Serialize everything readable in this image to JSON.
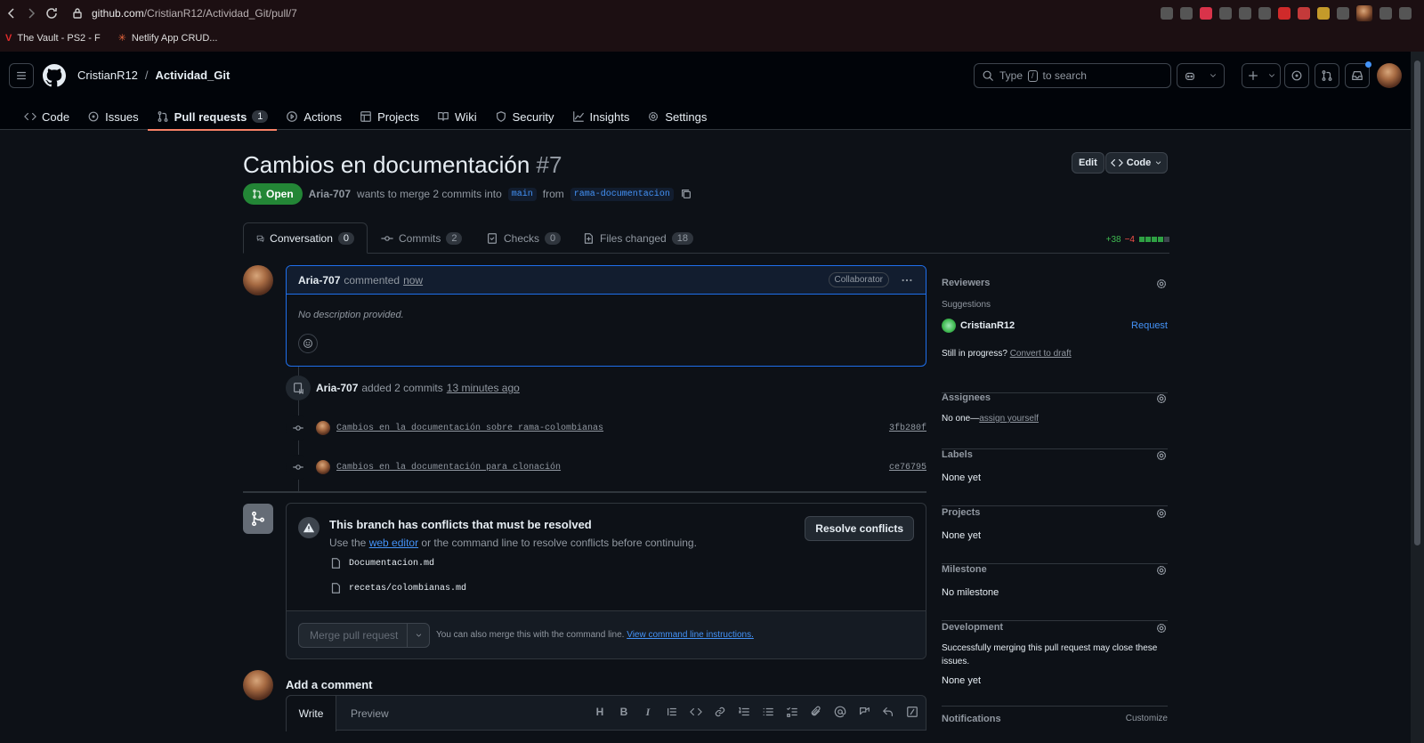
{
  "browser": {
    "url_host": "github.com",
    "url_path": "/CristianR12/Actividad_Git/pull/7",
    "bookmarks": [
      "The Vault - PS2 - F",
      "Netlify App CRUD..."
    ]
  },
  "header": {
    "owner": "CristianR12",
    "separator": "/",
    "repo": "Actividad_Git",
    "search_prefix": "Type",
    "search_key": "/",
    "search_suffix": "to search"
  },
  "repo_tabs": [
    {
      "label": "Code",
      "icon": "code-icon"
    },
    {
      "label": "Issues",
      "icon": "issue-icon"
    },
    {
      "label": "Pull requests",
      "icon": "pull-request-icon",
      "count": "1",
      "active": true
    },
    {
      "label": "Actions",
      "icon": "play-icon"
    },
    {
      "label": "Projects",
      "icon": "table-icon"
    },
    {
      "label": "Wiki",
      "icon": "book-icon"
    },
    {
      "label": "Security",
      "icon": "shield-icon"
    },
    {
      "label": "Insights",
      "icon": "graph-icon"
    },
    {
      "label": "Settings",
      "icon": "gear-icon"
    }
  ],
  "pr": {
    "title": "Cambios en documentación",
    "number": "#7",
    "edit_label": "Edit",
    "code_label": "Code",
    "state": "Open",
    "author": "Aria-707",
    "merge_text": "wants to merge 2 commits into",
    "base_branch": "main",
    "from_text": "from",
    "head_branch": "rama-documentacion"
  },
  "pr_tabs": [
    {
      "label": "Conversation",
      "count": "0"
    },
    {
      "label": "Commits",
      "count": "2"
    },
    {
      "label": "Files changed",
      "count": "18"
    },
    {
      "label": "Checks",
      "count": "0"
    }
  ],
  "diffstat": {
    "additions": "+38",
    "deletions": "−4",
    "blocks_green": 0.8
  },
  "comment": {
    "author": "Aria-707",
    "action": "commented",
    "time": "now",
    "role": "Collaborator",
    "body": "No description provided."
  },
  "timeline": {
    "author": "Aria-707",
    "action": "added 2 commits",
    "time": "13 minutes ago",
    "commits": [
      {
        "message": "Cambios en la documentación sobre rama-colombianas",
        "sha": "3fb280f"
      },
      {
        "message": "Cambios en la documentación para clonación",
        "sha": "ce76795"
      }
    ]
  },
  "merge": {
    "title": "This branch has conflicts that must be resolved",
    "sub_pre": "Use the",
    "sub_link": "web editor",
    "sub_post": "or the command line to resolve conflicts before continuing.",
    "resolve_label": "Resolve conflicts",
    "files": [
      "Documentacion.md",
      "recetas/colombianas.md"
    ],
    "merge_label": "Merge pull request",
    "cmd_text": "You can also merge this with the command line.",
    "cmd_link": "View command line instructions."
  },
  "add_comment": {
    "title": "Add a comment",
    "write": "Write",
    "preview": "Preview",
    "toolbar": [
      "H",
      "B",
      "I"
    ]
  },
  "sidebar": {
    "reviewers": {
      "title": "Reviewers",
      "suggestions": "Suggestions",
      "user": "CristianR12",
      "request": "Request",
      "progress": "Still in progress?",
      "draft": "Convert to draft"
    },
    "assignees": {
      "title": "Assignees",
      "value": "No one—",
      "link": "assign yourself"
    },
    "labels": {
      "title": "Labels",
      "value": "None yet"
    },
    "projects": {
      "title": "Projects",
      "value": "None yet"
    },
    "milestone": {
      "title": "Milestone",
      "value": "No milestone"
    },
    "development": {
      "title": "Development",
      "desc": "Successfully merging this pull request may close these issues.",
      "value": "None yet"
    },
    "notifications": {
      "title": "Notifications",
      "customize": "Customize"
    }
  },
  "colors": {
    "open": "#238636",
    "accent": "#4493f8",
    "tab_underline": "#f78166"
  }
}
